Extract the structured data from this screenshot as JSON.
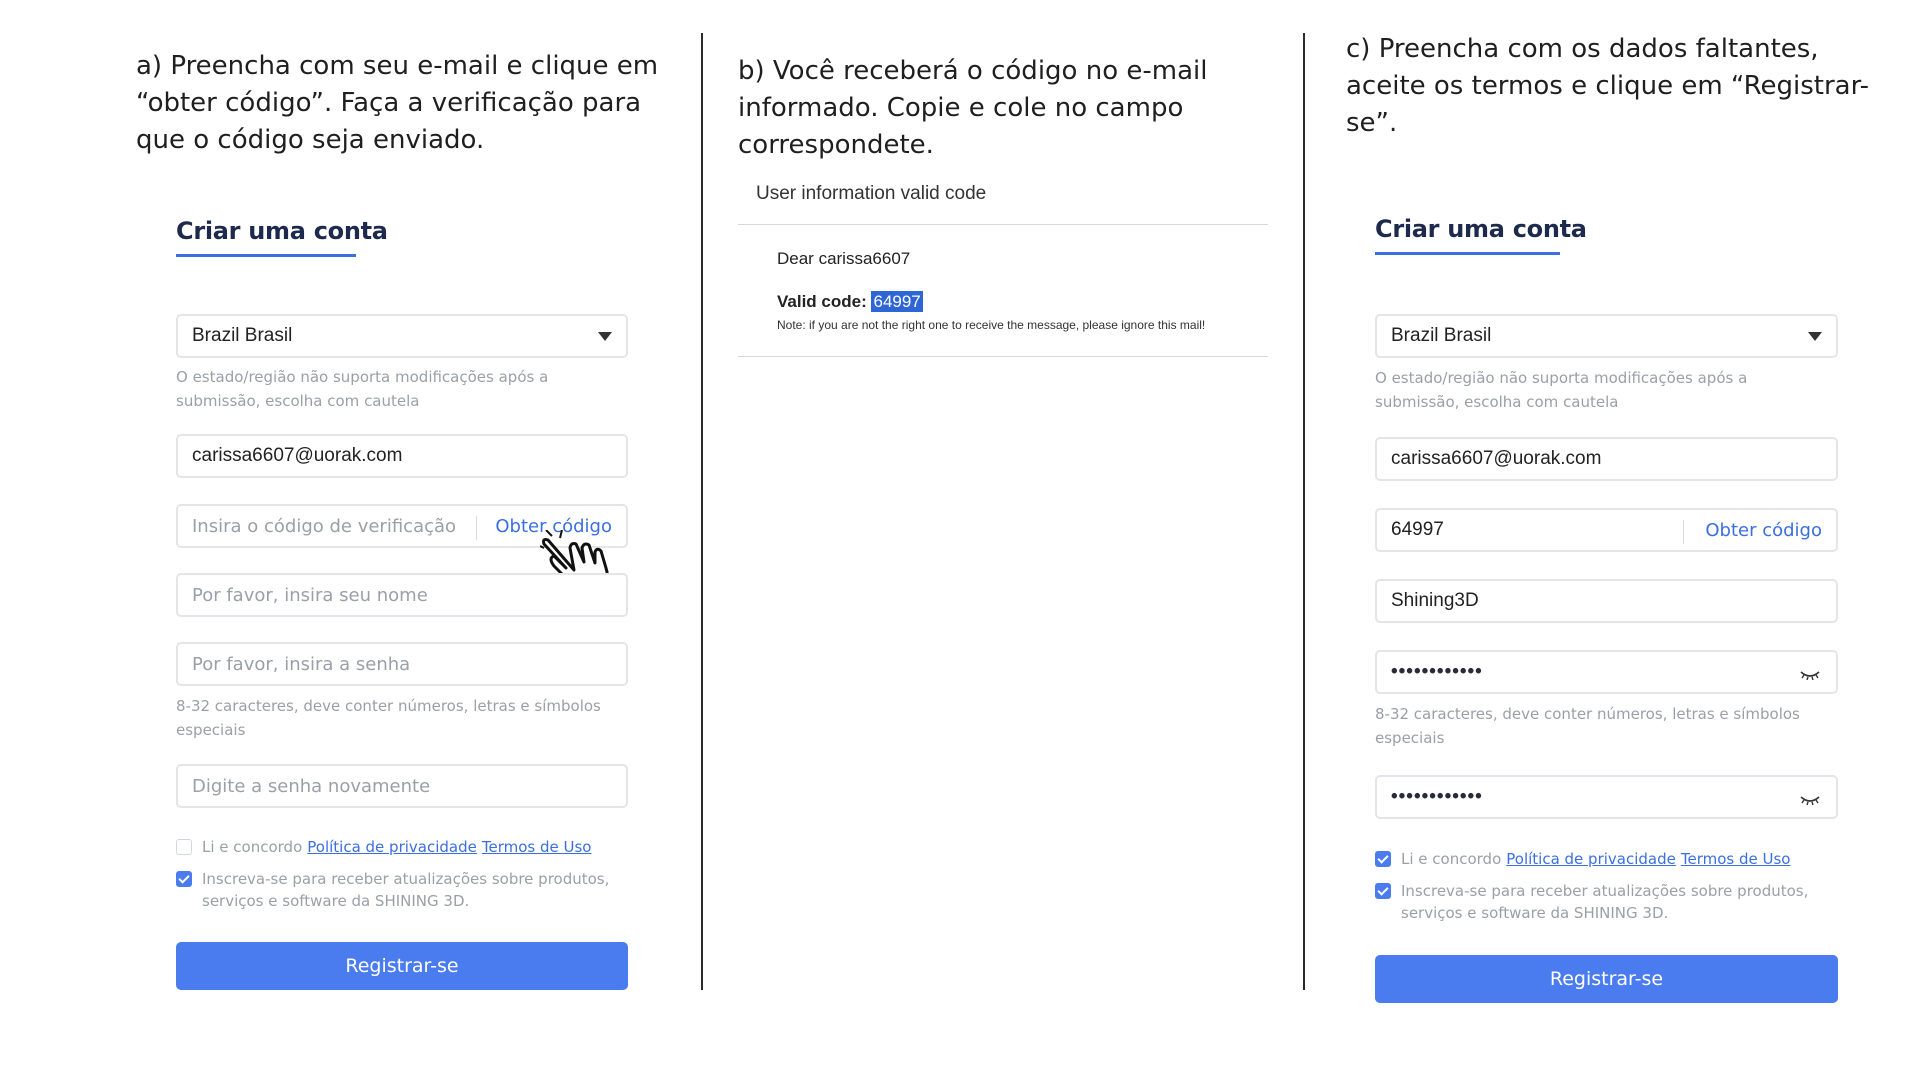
{
  "captions": {
    "a": "a) Preencha com seu e-mail e clique em “obter código”. Faça a verificação para que o código seja enviado.",
    "b": "b) Você receberá o código no e-mail informado. Copie e cole no campo correspondete.",
    "c": "c) Preencha com os dados faltantes, aceite os termos e clique em “Registrar-se”."
  },
  "form_a": {
    "title": "Criar uma conta",
    "country": "Brazil Brasil",
    "country_hint": "O estado/região não suporta modificações após a submissão, escolha com cautela",
    "email": "carissa6607@uorak.com",
    "code_placeholder": "Insira o código de verificação",
    "get_code": "Obter código",
    "name_placeholder": "Por favor, insira seu nome",
    "password_placeholder": "Por favor, insira a senha",
    "password_hint": "8-32 caracteres, deve conter números, letras e símbolos especiais",
    "confirm_placeholder": "Digite a senha novamente",
    "agree_text": "Li e concordo",
    "privacy_link": "Política de privacidade",
    "terms_link": "Termos de Uso",
    "agree_checked": false,
    "subscribe_text": "Inscreva-se para receber atualizações sobre produtos, serviços e software da SHINING 3D.",
    "subscribe_checked": true,
    "register": "Registrar-se"
  },
  "email": {
    "header": "User information valid code",
    "greeting": "Dear carissa6607",
    "code_label": "Valid code:",
    "code": "64997",
    "note": "Note: if you are not the right one to receive the message, please ignore this mail!"
  },
  "form_c": {
    "title": "Criar uma conta",
    "country": "Brazil Brasil",
    "country_hint": "O estado/região não suporta modificações após a submissão, escolha com cautela",
    "email": "carissa6607@uorak.com",
    "code": "64997",
    "get_code": "Obter código",
    "name": "Shining3D",
    "password": "••••••••••••",
    "password_hint": "8-32 caracteres, deve conter números, letras e símbolos especiais",
    "confirm": "••••••••••••",
    "agree_text": "Li e concordo",
    "privacy_link": "Política de privacidade",
    "terms_link": "Termos de Uso",
    "agree_checked": true,
    "subscribe_text": "Inscreva-se para receber atualizações sobre produtos, serviços e software da SHINING 3D.",
    "subscribe_checked": true,
    "register": "Registrar-se"
  },
  "colors": {
    "accent": "#4a7cf0",
    "link": "#3b6fe0",
    "highlight": "#2e66d6"
  },
  "icons": [
    "hand-pointer-icon",
    "caret-down-icon",
    "eye-closed-icon",
    "checkbox-checked-icon"
  ]
}
